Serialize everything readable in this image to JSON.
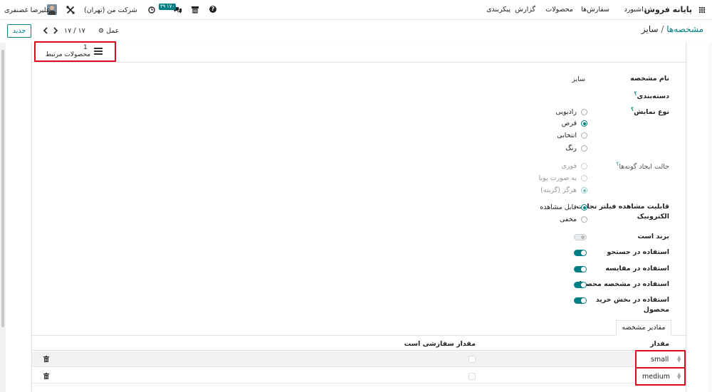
{
  "topnav": {
    "app_name": "پایانه فروش",
    "menu": [
      "داشبورد",
      "سفارش‌ها",
      "محصولات",
      "گزارش",
      "پیکربندی"
    ],
    "user_name": "علیرضا غضنفری",
    "company": "شرکت من (تهران)",
    "activity_badge": "۳۹",
    "chat_badge": "۱۷۰"
  },
  "control_panel": {
    "breadcrumb_parent": "مشخصه‌ها",
    "breadcrumb_sep": "/",
    "breadcrumb_current": "سایز",
    "new_button": "جدید",
    "action_label": "عمل",
    "pager": "۱۷ / ۱۷"
  },
  "button_box": {
    "related_products_count": "1",
    "related_products_label": "محصولات مرتبط"
  },
  "form": {
    "name_label": "نام مشخصه",
    "name_value": "سایز",
    "category_label": "دسته‌بندی",
    "display_type_label": "نوع نمایش",
    "display_types": [
      {
        "label": "رادیویی",
        "checked": false
      },
      {
        "label": "قرص",
        "checked": true
      },
      {
        "label": "انتخابی",
        "checked": false
      },
      {
        "label": "رنگ",
        "checked": false
      }
    ],
    "variant_creation_label": "حالت ایجاد گونه‌ها",
    "variant_modes": [
      {
        "label": "فوری",
        "checked": false
      },
      {
        "label": "به صورت پویا",
        "checked": false
      },
      {
        "label": "هرگز (گزینه)",
        "checked": true
      }
    ],
    "ecommerce_visibility_label_1": "قابلیت مشاهده فیلتر تجارت",
    "ecommerce_visibility_label_2": "الکترونیک",
    "visibility_options": [
      {
        "label": "قابل مشاهده",
        "checked": true
      },
      {
        "label": "مخفی",
        "checked": false
      }
    ],
    "is_brand_label": "برند است",
    "search_label": "استفاده در جستجو",
    "compare_label": "استفاده در مقایسه",
    "spec_label": "استفاده در مشخصه محصول",
    "purchase_label_1": "استفاده در بخش خرید",
    "purchase_label_2": "محصول",
    "help_mark": "؟"
  },
  "values_tab": {
    "tab_label": "مقادیر مشخصه",
    "col_value": "مقدار",
    "col_custom": "مقدار سفارشی است",
    "rows": [
      {
        "value": "small"
      },
      {
        "value": "medium"
      }
    ]
  },
  "colors": {
    "accent": "#017e84",
    "highlight": "#e0061b"
  }
}
